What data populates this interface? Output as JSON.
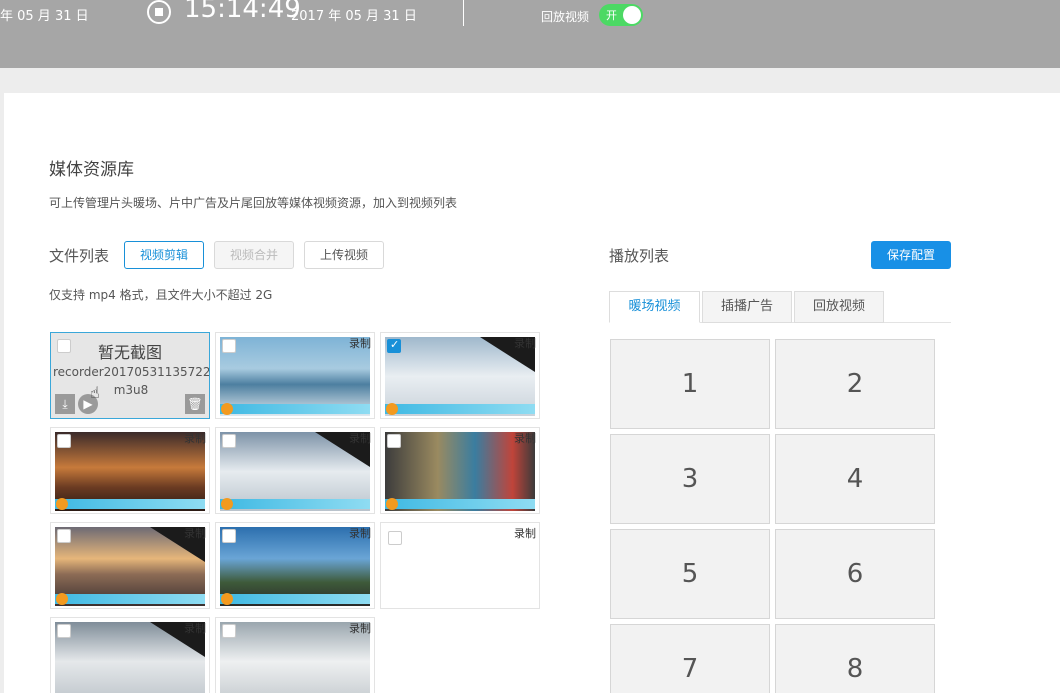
{
  "topbar": {
    "date_left": "年 05 月 31 日",
    "time": "15:14:49",
    "date": "2017 年 05 月 31 日",
    "replay_label": "回放视频",
    "toggle_label": "开",
    "toggle_on": true
  },
  "library": {
    "title": "媒体资源库",
    "description": "可上传管理片头暖场、片中广告及片尾回放等媒体视频资源，加入到视频列表"
  },
  "filelist": {
    "label": "文件列表",
    "edit_button": "视频剪辑",
    "merge_button": "视频合并",
    "upload_button": "上传视频",
    "note": "仅支持 mp4 格式，且文件大小不超过 2G"
  },
  "media": {
    "first_item": {
      "no_image_text": "暂无截图",
      "filename_line1": "recorder20170531135722.",
      "filename_line2": "m3u8"
    },
    "record_label": "录制"
  },
  "playlist": {
    "label": "播放列表",
    "save_button": "保存配置",
    "tabs": [
      "暖场视频",
      "插播广告",
      "回放视频"
    ],
    "active_tab": 0,
    "slots": [
      "1",
      "2",
      "3",
      "4",
      "5",
      "6",
      "7",
      "8"
    ]
  },
  "colors": {
    "accent": "#1890d8",
    "toggle": "#4cd964",
    "topbar": "#a6a6a6"
  },
  "icons": [
    "stop-icon",
    "download-icon",
    "play-icon",
    "trash-icon",
    "hand-cursor-icon"
  ]
}
